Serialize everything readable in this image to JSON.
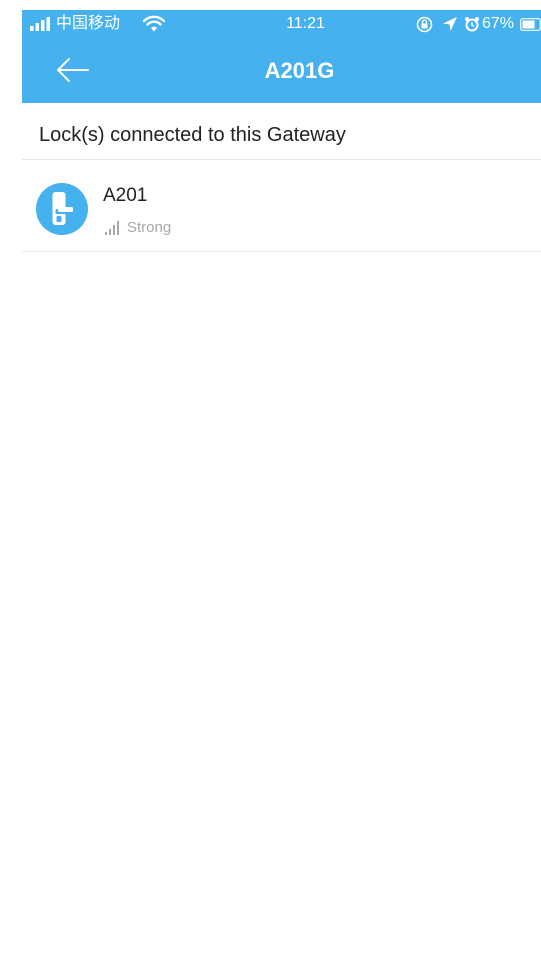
{
  "status_bar": {
    "carrier": "中国移动",
    "time": "11:21",
    "battery_percent": "67%",
    "icons": [
      "signal-icon",
      "wifi-icon",
      "rotation-lock-icon",
      "location-icon",
      "alarm-icon",
      "battery-icon"
    ]
  },
  "nav": {
    "title": "A201G",
    "back_icon": "back-arrow-icon"
  },
  "section": {
    "title": "Lock(s) connected to this Gateway"
  },
  "locks": [
    {
      "name": "A201",
      "signal_label": "Strong",
      "icon": "lock-icon",
      "signal_icon": "signal-strength-icon"
    }
  ],
  "colors": {
    "header": "#45b1ef",
    "lock_avatar": "#45b1ef",
    "muted_text": "#a8a8a8",
    "divider": "#e6e6e6"
  }
}
